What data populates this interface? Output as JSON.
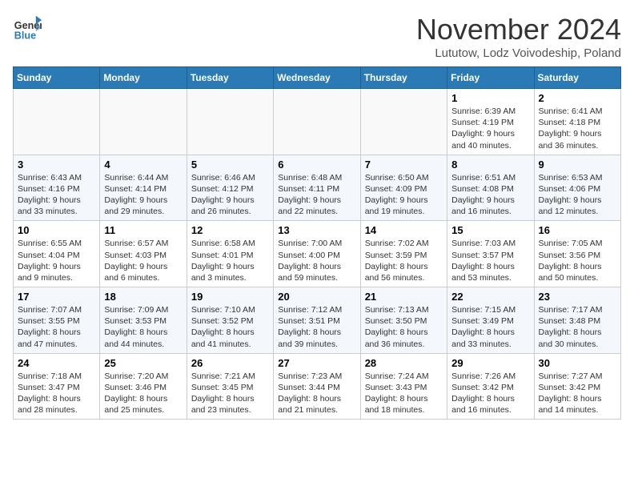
{
  "header": {
    "logo_general": "General",
    "logo_blue": "Blue",
    "month_title": "November 2024",
    "subtitle": "Lututow, Lodz Voivodeship, Poland"
  },
  "weekdays": [
    "Sunday",
    "Monday",
    "Tuesday",
    "Wednesday",
    "Thursday",
    "Friday",
    "Saturday"
  ],
  "weeks": [
    [
      {
        "day": "",
        "info": ""
      },
      {
        "day": "",
        "info": ""
      },
      {
        "day": "",
        "info": ""
      },
      {
        "day": "",
        "info": ""
      },
      {
        "day": "",
        "info": ""
      },
      {
        "day": "1",
        "info": "Sunrise: 6:39 AM\nSunset: 4:19 PM\nDaylight: 9 hours and 40 minutes."
      },
      {
        "day": "2",
        "info": "Sunrise: 6:41 AM\nSunset: 4:18 PM\nDaylight: 9 hours and 36 minutes."
      }
    ],
    [
      {
        "day": "3",
        "info": "Sunrise: 6:43 AM\nSunset: 4:16 PM\nDaylight: 9 hours and 33 minutes."
      },
      {
        "day": "4",
        "info": "Sunrise: 6:44 AM\nSunset: 4:14 PM\nDaylight: 9 hours and 29 minutes."
      },
      {
        "day": "5",
        "info": "Sunrise: 6:46 AM\nSunset: 4:12 PM\nDaylight: 9 hours and 26 minutes."
      },
      {
        "day": "6",
        "info": "Sunrise: 6:48 AM\nSunset: 4:11 PM\nDaylight: 9 hours and 22 minutes."
      },
      {
        "day": "7",
        "info": "Sunrise: 6:50 AM\nSunset: 4:09 PM\nDaylight: 9 hours and 19 minutes."
      },
      {
        "day": "8",
        "info": "Sunrise: 6:51 AM\nSunset: 4:08 PM\nDaylight: 9 hours and 16 minutes."
      },
      {
        "day": "9",
        "info": "Sunrise: 6:53 AM\nSunset: 4:06 PM\nDaylight: 9 hours and 12 minutes."
      }
    ],
    [
      {
        "day": "10",
        "info": "Sunrise: 6:55 AM\nSunset: 4:04 PM\nDaylight: 9 hours and 9 minutes."
      },
      {
        "day": "11",
        "info": "Sunrise: 6:57 AM\nSunset: 4:03 PM\nDaylight: 9 hours and 6 minutes."
      },
      {
        "day": "12",
        "info": "Sunrise: 6:58 AM\nSunset: 4:01 PM\nDaylight: 9 hours and 3 minutes."
      },
      {
        "day": "13",
        "info": "Sunrise: 7:00 AM\nSunset: 4:00 PM\nDaylight: 8 hours and 59 minutes."
      },
      {
        "day": "14",
        "info": "Sunrise: 7:02 AM\nSunset: 3:59 PM\nDaylight: 8 hours and 56 minutes."
      },
      {
        "day": "15",
        "info": "Sunrise: 7:03 AM\nSunset: 3:57 PM\nDaylight: 8 hours and 53 minutes."
      },
      {
        "day": "16",
        "info": "Sunrise: 7:05 AM\nSunset: 3:56 PM\nDaylight: 8 hours and 50 minutes."
      }
    ],
    [
      {
        "day": "17",
        "info": "Sunrise: 7:07 AM\nSunset: 3:55 PM\nDaylight: 8 hours and 47 minutes."
      },
      {
        "day": "18",
        "info": "Sunrise: 7:09 AM\nSunset: 3:53 PM\nDaylight: 8 hours and 44 minutes."
      },
      {
        "day": "19",
        "info": "Sunrise: 7:10 AM\nSunset: 3:52 PM\nDaylight: 8 hours and 41 minutes."
      },
      {
        "day": "20",
        "info": "Sunrise: 7:12 AM\nSunset: 3:51 PM\nDaylight: 8 hours and 39 minutes."
      },
      {
        "day": "21",
        "info": "Sunrise: 7:13 AM\nSunset: 3:50 PM\nDaylight: 8 hours and 36 minutes."
      },
      {
        "day": "22",
        "info": "Sunrise: 7:15 AM\nSunset: 3:49 PM\nDaylight: 8 hours and 33 minutes."
      },
      {
        "day": "23",
        "info": "Sunrise: 7:17 AM\nSunset: 3:48 PM\nDaylight: 8 hours and 30 minutes."
      }
    ],
    [
      {
        "day": "24",
        "info": "Sunrise: 7:18 AM\nSunset: 3:47 PM\nDaylight: 8 hours and 28 minutes."
      },
      {
        "day": "25",
        "info": "Sunrise: 7:20 AM\nSunset: 3:46 PM\nDaylight: 8 hours and 25 minutes."
      },
      {
        "day": "26",
        "info": "Sunrise: 7:21 AM\nSunset: 3:45 PM\nDaylight: 8 hours and 23 minutes."
      },
      {
        "day": "27",
        "info": "Sunrise: 7:23 AM\nSunset: 3:44 PM\nDaylight: 8 hours and 21 minutes."
      },
      {
        "day": "28",
        "info": "Sunrise: 7:24 AM\nSunset: 3:43 PM\nDaylight: 8 hours and 18 minutes."
      },
      {
        "day": "29",
        "info": "Sunrise: 7:26 AM\nSunset: 3:42 PM\nDaylight: 8 hours and 16 minutes."
      },
      {
        "day": "30",
        "info": "Sunrise: 7:27 AM\nSunset: 3:42 PM\nDaylight: 8 hours and 14 minutes."
      }
    ]
  ]
}
